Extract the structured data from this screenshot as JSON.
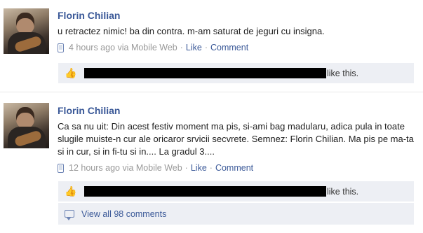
{
  "stories": [
    {
      "author": "Florin Chilian",
      "message": "u retractez nimic! ba din contra. m-am saturat de jeguri cu insigna.",
      "time": "4 hours ago via Mobile Web",
      "like_link": "Like",
      "comment_link": "Comment",
      "like_suffix": "like this."
    },
    {
      "author": "Florin Chilian",
      "message": "Ca sa nu uit: Din acest festiv moment ma pis, si-ami bag madularu, adica pula in toate slugile muiste-n cur ale oricaror srvicii secvrete. Semnez: Florin Chilian. Ma pis pe ma-ta si in cur, si in fi-tu si in.... La gradul 3....",
      "time": "12 hours ago via Mobile Web",
      "like_link": "Like",
      "comment_link": "Comment",
      "like_suffix": "like this.",
      "view_all_comments": "View all 98 comments"
    }
  ],
  "icons": {
    "like": "thumbs-up-icon",
    "mobile": "mobile-phone-icon",
    "comment": "comment-bubble-icon"
  },
  "colors": {
    "link": "#3b5998",
    "meta": "#999999",
    "feedback_bg": "#edeff4"
  }
}
